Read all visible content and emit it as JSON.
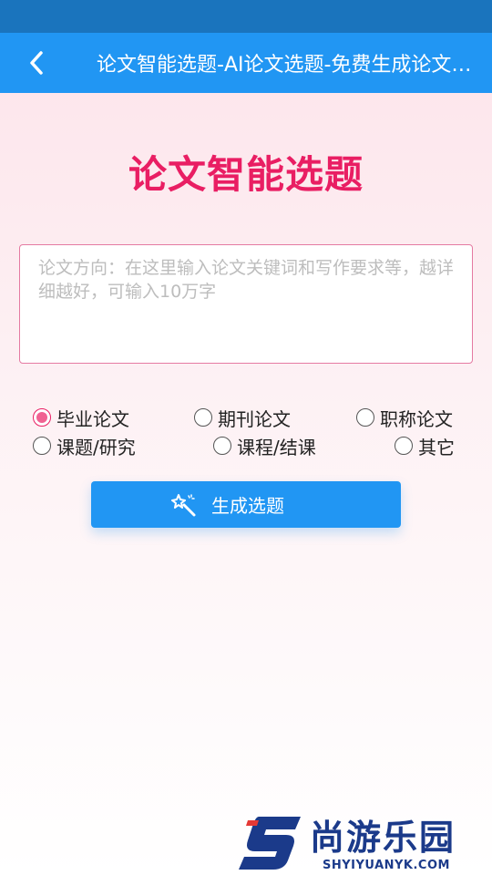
{
  "nav": {
    "title": "论文智能选题-AI论文选题-免费生成论文选题"
  },
  "page": {
    "heading": "论文智能选题"
  },
  "input": {
    "placeholder": "论文方向：在这里输入论文关键词和写作要求等，越详细越好，可输入10万字",
    "value": ""
  },
  "radios": [
    {
      "label": "毕业论文",
      "checked": true
    },
    {
      "label": "期刊论文",
      "checked": false
    },
    {
      "label": "职称论文",
      "checked": false
    },
    {
      "label": "课题/研究",
      "checked": false
    },
    {
      "label": "课程/结课",
      "checked": false
    },
    {
      "label": "其它",
      "checked": false
    }
  ],
  "button": {
    "label": "生成选题",
    "icon": "magic-wand-icon"
  },
  "watermark": {
    "brand": "尚游乐园",
    "url": "SHYIYUANYK.COM"
  },
  "colors": {
    "status_bar": "#1a74bd",
    "nav_bar": "#2196f3",
    "accent": "#e91e63",
    "button": "#2196f3"
  }
}
